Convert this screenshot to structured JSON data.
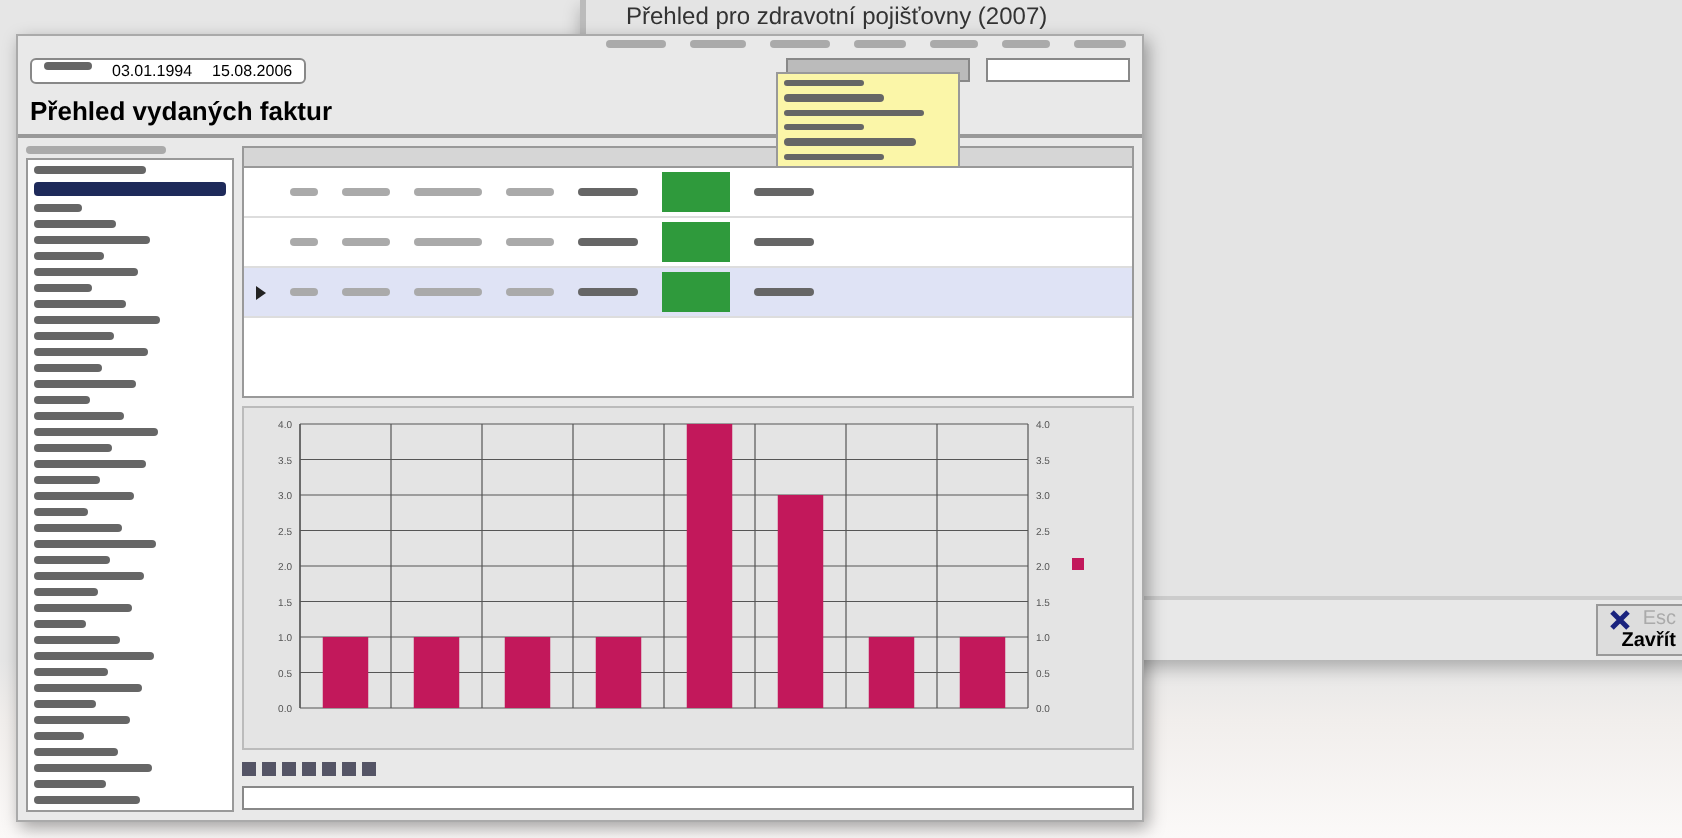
{
  "back_window": {
    "title": "Přehled pro zdravotní pojišťovny (2007)",
    "close_button": {
      "shortcut": "Esc",
      "label": "Zavřít"
    }
  },
  "front_window": {
    "date_range": {
      "from": "03.01.1994",
      "to": "15.08.2006"
    },
    "title": "Přehled vydaných faktur",
    "table": {
      "rows": [
        {
          "selected": false
        },
        {
          "selected": false
        },
        {
          "selected": true
        }
      ]
    },
    "chart_data": {
      "type": "bar",
      "grid": true,
      "ylim": [
        0,
        4
      ],
      "yticks": [
        {
          "value": 0,
          "label": "0.0"
        },
        {
          "value": 0.5,
          "label": "0.5"
        },
        {
          "value": 1,
          "label": "1.0"
        },
        {
          "value": 1.5,
          "label": "1.5"
        },
        {
          "value": 2,
          "label": "2.0"
        },
        {
          "value": 2.5,
          "label": "2.5"
        },
        {
          "value": 3,
          "label": "3.0"
        },
        {
          "value": 3.5,
          "label": "3.5"
        },
        {
          "value": 4,
          "label": "4.0"
        }
      ],
      "y2lim": [
        0,
        4
      ],
      "y2ticks": [
        {
          "value": 0,
          "label": "0.0"
        },
        {
          "value": 0.5,
          "label": "0.5"
        },
        {
          "value": 1,
          "label": "1.0"
        },
        {
          "value": 1.5,
          "label": "1.5"
        },
        {
          "value": 2,
          "label": "2.0"
        },
        {
          "value": 2.5,
          "label": "2.5"
        },
        {
          "value": 3,
          "label": "3.0"
        },
        {
          "value": 3.5,
          "label": "3.5"
        },
        {
          "value": 4,
          "label": "4.0"
        }
      ],
      "series": [
        {
          "color": "#c2185b",
          "values": [
            1,
            1,
            1,
            1,
            4,
            3,
            1,
            1
          ]
        }
      ]
    }
  }
}
